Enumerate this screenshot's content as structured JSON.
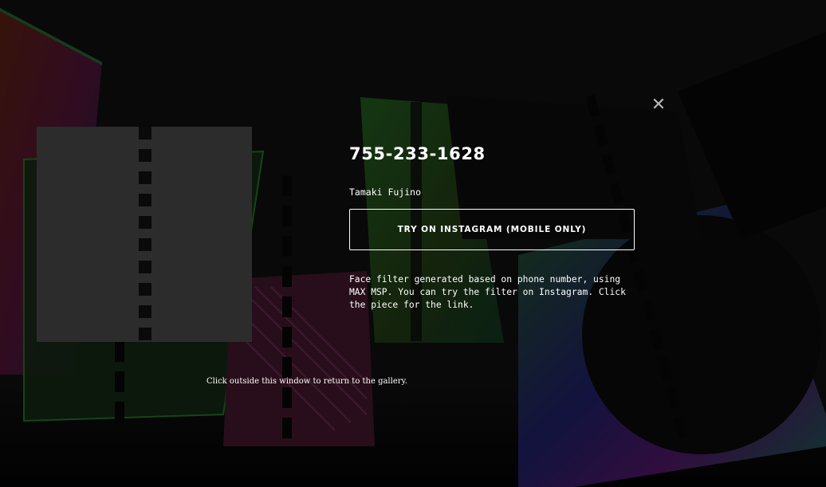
{
  "modal": {
    "title": "755-233-1628",
    "author": "Tamaki Fujino",
    "cta_label": "TRY ON INSTAGRAM (MOBILE ONLY)",
    "description": "Face filter generated based on phone number, using MAX MSP. You can try the filter on Instagram. Click the piece for the link.",
    "close_icon": "close-icon",
    "close_glyph": "✕"
  },
  "footer": {
    "hint": "Click outside this window to return to the gallery."
  },
  "colors": {
    "background": "#0b0b0b",
    "text": "#ffffff",
    "thumbnail": "#2c2c2c",
    "close": "#b8b8b8"
  }
}
